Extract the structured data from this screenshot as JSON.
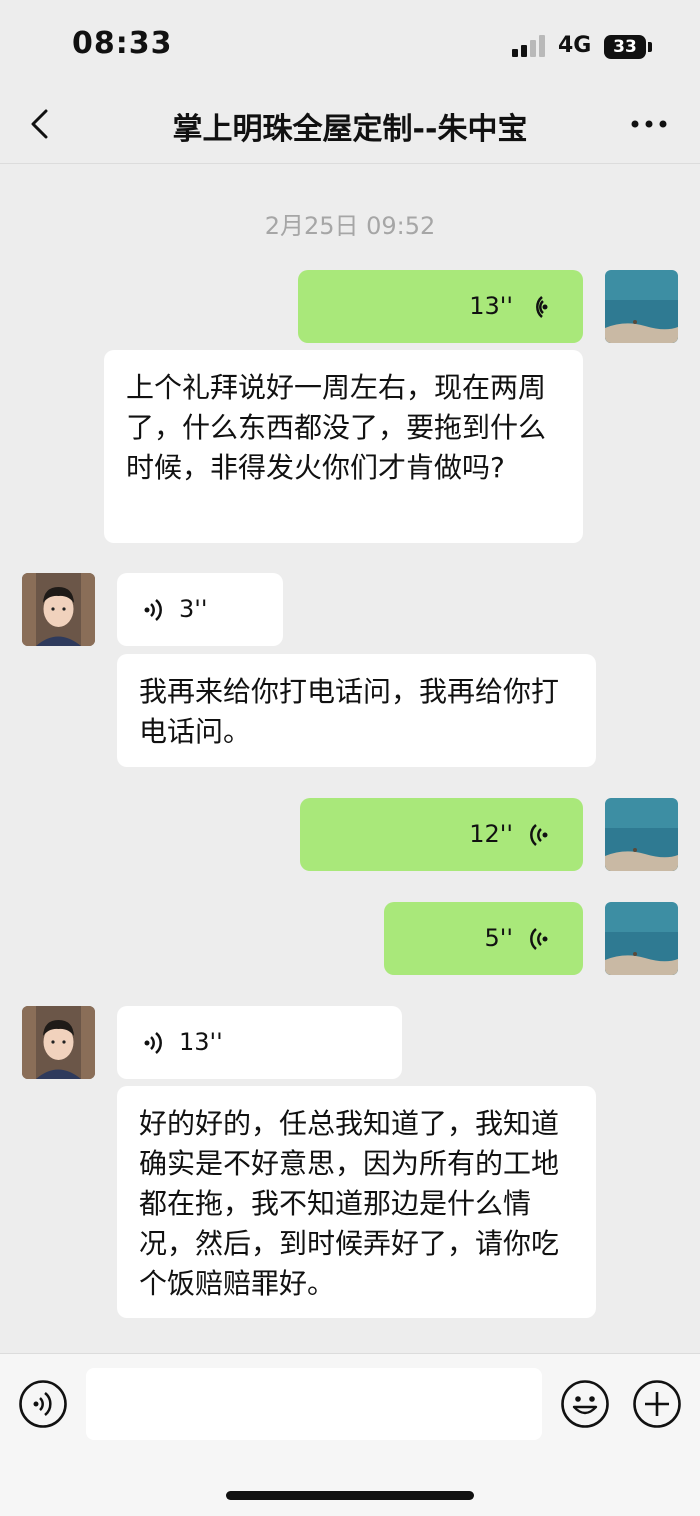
{
  "status_bar": {
    "time": "08:33",
    "network": "4G",
    "battery": "33"
  },
  "header": {
    "title": "掌上明珠全屋定制--朱中宝"
  },
  "chat": {
    "timestamp": "2月25日 09:52",
    "messages": [
      {
        "side": "right",
        "type": "voice",
        "duration": "13''"
      },
      {
        "side": "right",
        "type": "transcript",
        "text": "上个礼拜说好一周左右，现在两周了，什么东西都没了，要拖到什么时候，非得发火你们才肯做吗?"
      },
      {
        "side": "left",
        "type": "voice",
        "duration": "3''"
      },
      {
        "side": "left",
        "type": "transcript",
        "text": "我再来给你打电话问，我再给你打电话问。"
      },
      {
        "side": "right",
        "type": "voice",
        "duration": "12''"
      },
      {
        "side": "right",
        "type": "voice",
        "duration": "5''"
      },
      {
        "side": "left",
        "type": "voice",
        "duration": "13''"
      },
      {
        "side": "left",
        "type": "transcript",
        "text": "好的好的，任总我知道了，我知道确实是不好意思，因为所有的工地都在拖，我不知道那边是什么情况，然后，到时候弄好了，请你吃个饭赔赔罪好。"
      }
    ]
  },
  "input_bar": {
    "message_value": ""
  },
  "colors": {
    "sent_bubble": "#a9e87a",
    "received_bubble": "#ffffff",
    "background": "#ededed",
    "timestamp": "#a6a6a6"
  },
  "icons": [
    "back-arrow-icon",
    "more-dots-icon",
    "voice-wave-icon",
    "voice-mode-icon",
    "emoji-icon",
    "plus-icon",
    "signal-icon",
    "battery-icon"
  ]
}
